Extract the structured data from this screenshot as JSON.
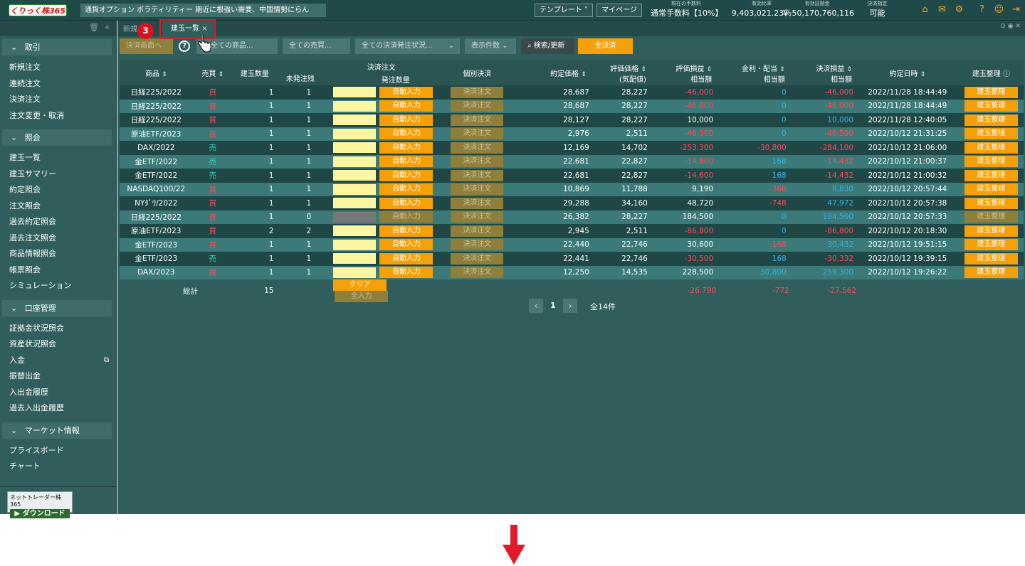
{
  "header": {
    "logo": "くりっく株365",
    "news": "通貨オプション ボラティリティー 期近に根強い需要、中国情勢にらん",
    "template": "テンプレート ˅",
    "mypage": "マイページ",
    "stats": [
      {
        "label": "現在の手数料",
        "value": "通常手数料【10%】"
      },
      {
        "label": "有効比率",
        "value": "9,403,021.23％"
      },
      {
        "label": "有効証拠金",
        "value": "￥ 50,170,760,116"
      },
      {
        "label": "決済指定",
        "value": "可能"
      }
    ]
  },
  "sidebar": {
    "sections": [
      {
        "title": "取引",
        "items": [
          "新規注文",
          "連続注文",
          "決済注文",
          "注文変更・取消"
        ]
      },
      {
        "title": "照会",
        "items": [
          "建玉一覧",
          "建玉サマリー",
          "約定照会",
          "注文照会",
          "過去約定照会",
          "過去注文照会",
          "商品情報照会",
          "帳票照会",
          "シミュレーション"
        ]
      },
      {
        "title": "口座管理",
        "items": [
          "証拠金状況照会",
          "資産状況照会",
          "入金",
          "振替出金",
          "入出金履歴",
          "過去入出金履歴"
        ]
      },
      {
        "title": "マーケット情報",
        "items": [
          "プライスボード",
          "チャート"
        ]
      }
    ],
    "download": {
      "title": "ネットトレーダー株365",
      "button": "ダウンロード"
    }
  },
  "tabs": {
    "tab1": "新規",
    "tab2": "建玉一覧",
    "badge": "3"
  },
  "filters": {
    "settle_screen": "決済画面へ",
    "product": "全ての商品...",
    "side": "全ての売買...",
    "status": "全ての決済発注状況...",
    "count": "表示件数",
    "search": "検索/更新",
    "settle_all": "全決済"
  },
  "table": {
    "headers": {
      "product": "商品",
      "side": "売買",
      "qty": "建玉数量",
      "unordered": "未発注残",
      "order": "決済注文",
      "order_qty": "発注数量",
      "individual": "個別決済",
      "exec_price": "約定価格",
      "eval_price": "評価価格",
      "eval_price2": "(気配値)",
      "eval_pl": "評価損益",
      "eval_pl2": "相当額",
      "interest": "金利・配当",
      "interest2": "相当額",
      "settle_pl": "決済損益",
      "settle_pl2": "相当額",
      "exec_date": "約定日時",
      "cleanup": "建玉整理"
    },
    "auto_label": "自動入力",
    "settle_label": "決済注文",
    "cleanup_label": "建玉整理",
    "rows": [
      {
        "product": "日経225/2022",
        "side": "買",
        "qty": "1",
        "unordered": "1",
        "exec": "28,687",
        "eval": "28,227",
        "pl": "-46,000",
        "int": "0",
        "spl": "-46,000",
        "date": "2022/11/28 18:44:49",
        "active": true
      },
      {
        "product": "日経225/2022",
        "side": "買",
        "qty": "1",
        "unordered": "1",
        "exec": "28,687",
        "eval": "28,227",
        "pl": "-46,000",
        "int": "0",
        "spl": "-46,000",
        "date": "2022/11/28 18:44:49",
        "active": true
      },
      {
        "product": "日経225/2022",
        "side": "買",
        "qty": "1",
        "unordered": "1",
        "exec": "28,127",
        "eval": "28,227",
        "pl": "10,000",
        "int": "0",
        "spl": "10,000",
        "date": "2022/11/28 12:40:05",
        "active": true
      },
      {
        "product": "原油ETF/2023",
        "side": "買",
        "qty": "1",
        "unordered": "1",
        "exec": "2,976",
        "eval": "2,511",
        "pl": "-46,500",
        "int": "0",
        "spl": "-46,500",
        "date": "2022/10/12 21:31:25",
        "active": true
      },
      {
        "product": "DAX/2022",
        "side": "売",
        "qty": "1",
        "unordered": "1",
        "exec": "12,169",
        "eval": "14,702",
        "pl": "-253,300",
        "int": "-30,800",
        "spl": "-284,100",
        "date": "2022/10/12 21:06:00",
        "active": true
      },
      {
        "product": "金ETF/2022",
        "side": "売",
        "qty": "1",
        "unordered": "1",
        "exec": "22,681",
        "eval": "22,827",
        "pl": "-14,600",
        "int": "168",
        "spl": "-14,432",
        "date": "2022/10/12 21:00:37",
        "active": true
      },
      {
        "product": "金ETF/2022",
        "side": "売",
        "qty": "1",
        "unordered": "1",
        "exec": "22,681",
        "eval": "22,827",
        "pl": "-14,600",
        "int": "168",
        "spl": "-14,432",
        "date": "2022/10/12 21:00:32",
        "active": true
      },
      {
        "product": "NASDAQ100/22",
        "side": "買",
        "qty": "1",
        "unordered": "1",
        "exec": "10,869",
        "eval": "11,788",
        "pl": "9,190",
        "int": "-360",
        "spl": "8,830",
        "date": "2022/10/12 20:57:44",
        "active": true
      },
      {
        "product": "NYﾀﾞｳ/2022",
        "side": "買",
        "qty": "1",
        "unordered": "1",
        "exec": "29,288",
        "eval": "34,160",
        "pl": "48,720",
        "int": "-748",
        "spl": "47,972",
        "date": "2022/10/12 20:57:38",
        "active": true
      },
      {
        "product": "日経225/2022",
        "side": "買",
        "qty": "1",
        "unordered": "0",
        "exec": "26,382",
        "eval": "28,227",
        "pl": "184,500",
        "int": "0",
        "spl": "184,500",
        "date": "2022/10/12 20:57:33",
        "active": false
      },
      {
        "product": "原油ETF/2023",
        "side": "買",
        "qty": "2",
        "unordered": "2",
        "exec": "2,945",
        "eval": "2,511",
        "pl": "-86,800",
        "int": "0",
        "spl": "-86,800",
        "date": "2022/10/12 20:18:30",
        "active": true
      },
      {
        "product": "金ETF/2023",
        "side": "買",
        "qty": "1",
        "unordered": "1",
        "exec": "22,440",
        "eval": "22,746",
        "pl": "30,600",
        "int": "-168",
        "spl": "30,432",
        "date": "2022/10/12 19:51:15",
        "active": true
      },
      {
        "product": "金ETF/2023",
        "side": "売",
        "qty": "1",
        "unordered": "1",
        "exec": "22,441",
        "eval": "22,746",
        "pl": "-30,500",
        "int": "168",
        "spl": "-30,332",
        "date": "2022/10/12 19:39:15",
        "active": true
      },
      {
        "product": "DAX/2023",
        "side": "買",
        "qty": "1",
        "unordered": "1",
        "exec": "12,250",
        "eval": "14,535",
        "pl": "228,500",
        "int": "30,800",
        "spl": "259,300",
        "date": "2022/10/12 19:26:22",
        "active": true
      }
    ],
    "footer": {
      "label": "総計",
      "qty": "15",
      "clear": "クリア",
      "all_input": "全入力",
      "pl": "-26,790",
      "int": "-772",
      "spl": "-27,562"
    }
  },
  "pager": {
    "page": "1",
    "total": "全14件"
  },
  "colors": {
    "negative": "#ff4b5c",
    "positive": "#36b3e6",
    "orange": "#f5a009",
    "highlight": "#e01a2b"
  }
}
